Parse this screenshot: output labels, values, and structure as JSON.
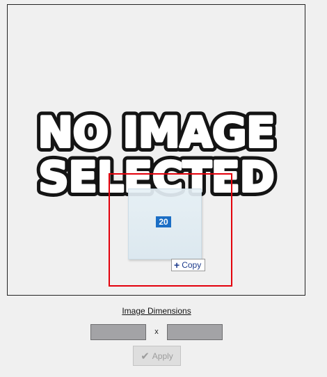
{
  "preview": {
    "placeholder_line1": "NO IMAGE",
    "placeholder_line2": "SELECTED"
  },
  "drag": {
    "count": "20",
    "copy_label": "Copy",
    "plus_icon": "plus-icon"
  },
  "dimensions": {
    "link_label": "Image Dimensions",
    "width_value": "",
    "height_value": "",
    "separator": "x"
  },
  "apply": {
    "label": "Apply",
    "icon": "check-icon",
    "enabled": false
  },
  "colors": {
    "selection_border": "#e3000b",
    "badge_background": "#0a63c2",
    "tooltip_text": "#1c3b8c"
  }
}
